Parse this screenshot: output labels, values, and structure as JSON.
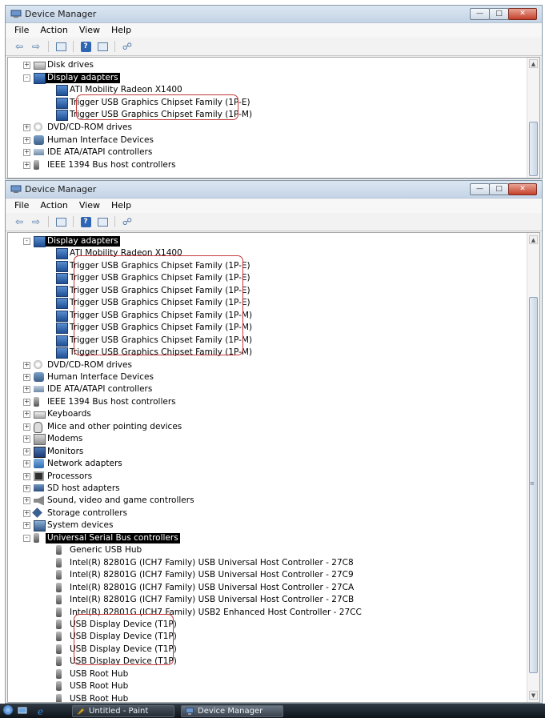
{
  "window1": {
    "title": "Device Manager",
    "menu": [
      "File",
      "Action",
      "View",
      "Help"
    ],
    "tree": [
      {
        "label": "Disk drives",
        "level": 1,
        "icon": "disk-drive-icon",
        "expander": "+"
      },
      {
        "label": "Display adapters",
        "level": 1,
        "icon": "display-adapter-icon",
        "expander": "-",
        "selected": true
      },
      {
        "label": "ATI Mobility Radeon X1400",
        "level": 2,
        "icon": "display-adapter-icon"
      },
      {
        "label": "Trigger USB Graphics Chipset Family (1P-E)",
        "level": 2,
        "icon": "display-adapter-icon"
      },
      {
        "label": "Trigger USB Graphics Chipset Family (1P-M)",
        "level": 2,
        "icon": "display-adapter-icon"
      },
      {
        "label": "DVD/CD-ROM drives",
        "level": 1,
        "icon": "dvd-drive-icon",
        "expander": "+"
      },
      {
        "label": "Human Interface Devices",
        "level": 1,
        "icon": "human-interface-icon",
        "expander": "+"
      },
      {
        "label": "IDE ATA/ATAPI controllers",
        "level": 1,
        "icon": "ide-controller-icon",
        "expander": "+"
      },
      {
        "label": "IEEE 1394 Bus host controllers",
        "level": 1,
        "icon": "usb-plug-icon",
        "expander": "+"
      }
    ]
  },
  "window2": {
    "title": "Device Manager",
    "menu": [
      "File",
      "Action",
      "View",
      "Help"
    ],
    "tree": [
      {
        "label": "Display adapters",
        "level": 1,
        "icon": "display-adapter-icon",
        "expander": "-",
        "selected": true
      },
      {
        "label": "ATI Mobility Radeon X1400",
        "level": 2,
        "icon": "display-adapter-icon"
      },
      {
        "label": "Trigger USB Graphics Chipset Family (1P-E)",
        "level": 2,
        "icon": "display-adapter-icon"
      },
      {
        "label": "Trigger USB Graphics Chipset Family (1P-E)",
        "level": 2,
        "icon": "display-adapter-icon"
      },
      {
        "label": "Trigger USB Graphics Chipset Family (1P-E)",
        "level": 2,
        "icon": "display-adapter-icon"
      },
      {
        "label": "Trigger USB Graphics Chipset Family (1P-E)",
        "level": 2,
        "icon": "display-adapter-icon"
      },
      {
        "label": "Trigger USB Graphics Chipset Family (1P-M)",
        "level": 2,
        "icon": "display-adapter-icon"
      },
      {
        "label": "Trigger USB Graphics Chipset Family (1P-M)",
        "level": 2,
        "icon": "display-adapter-icon"
      },
      {
        "label": "Trigger USB Graphics Chipset Family (1P-M)",
        "level": 2,
        "icon": "display-adapter-icon"
      },
      {
        "label": "Trigger USB Graphics Chipset Family (1P-M)",
        "level": 2,
        "icon": "display-adapter-icon"
      },
      {
        "label": "DVD/CD-ROM drives",
        "level": 1,
        "icon": "dvd-drive-icon",
        "expander": "+"
      },
      {
        "label": "Human Interface Devices",
        "level": 1,
        "icon": "human-interface-icon",
        "expander": "+"
      },
      {
        "label": "IDE ATA/ATAPI controllers",
        "level": 1,
        "icon": "ide-controller-icon",
        "expander": "+"
      },
      {
        "label": "IEEE 1394 Bus host controllers",
        "level": 1,
        "icon": "usb-plug-icon",
        "expander": "+"
      },
      {
        "label": "Keyboards",
        "level": 1,
        "icon": "keyboard-icon",
        "expander": "+"
      },
      {
        "label": "Mice and other pointing devices",
        "level": 1,
        "icon": "mouse-icon",
        "expander": "+"
      },
      {
        "label": "Modems",
        "level": 1,
        "icon": "modem-icon",
        "expander": "+"
      },
      {
        "label": "Monitors",
        "level": 1,
        "icon": "monitor-icon",
        "expander": "+"
      },
      {
        "label": "Network adapters",
        "level": 1,
        "icon": "network-adapter-icon",
        "expander": "+"
      },
      {
        "label": "Processors",
        "level": 1,
        "icon": "processor-icon",
        "expander": "+"
      },
      {
        "label": "SD host adapters",
        "level": 1,
        "icon": "sd-host-icon",
        "expander": "+"
      },
      {
        "label": "Sound, video and game controllers",
        "level": 1,
        "icon": "speaker-icon",
        "expander": "+"
      },
      {
        "label": "Storage controllers",
        "level": 1,
        "icon": "storage-controller-icon",
        "expander": "+"
      },
      {
        "label": "System devices",
        "level": 1,
        "icon": "system-device-icon",
        "expander": "+"
      },
      {
        "label": "Universal Serial Bus controllers",
        "level": 1,
        "icon": "usb-plug-icon",
        "expander": "-",
        "selected": true
      },
      {
        "label": "Generic USB Hub",
        "level": 2,
        "icon": "usb-plug-icon"
      },
      {
        "label": "Intel(R) 82801G (ICH7 Family) USB Universal Host Controller - 27C8",
        "level": 2,
        "icon": "usb-plug-icon"
      },
      {
        "label": "Intel(R) 82801G (ICH7 Family) USB Universal Host Controller - 27C9",
        "level": 2,
        "icon": "usb-plug-icon"
      },
      {
        "label": "Intel(R) 82801G (ICH7 Family) USB Universal Host Controller - 27CA",
        "level": 2,
        "icon": "usb-plug-icon"
      },
      {
        "label": "Intel(R) 82801G (ICH7 Family) USB Universal Host Controller - 27CB",
        "level": 2,
        "icon": "usb-plug-icon"
      },
      {
        "label": "Intel(R) 82801G (ICH7 Family) USB2 Enhanced Host Controller - 27CC",
        "level": 2,
        "icon": "usb-plug-icon"
      },
      {
        "label": "USB Display Device (T1P)",
        "level": 2,
        "icon": "usb-plug-icon"
      },
      {
        "label": "USB Display Device (T1P)",
        "level": 2,
        "icon": "usb-plug-icon"
      },
      {
        "label": "USB Display Device (T1P)",
        "level": 2,
        "icon": "usb-plug-icon"
      },
      {
        "label": "USB Display Device (T1P)",
        "level": 2,
        "icon": "usb-plug-icon"
      },
      {
        "label": "USB Root Hub",
        "level": 2,
        "icon": "usb-plug-icon"
      },
      {
        "label": "USB Root Hub",
        "level": 2,
        "icon": "usb-plug-icon"
      },
      {
        "label": "USB Root Hub",
        "level": 2,
        "icon": "usb-plug-icon"
      }
    ]
  },
  "taskbar": {
    "buttons": [
      {
        "label": "Untitled - Paint",
        "active": false
      },
      {
        "label": "Device Manager",
        "active": true
      }
    ]
  },
  "colors": {
    "highlight_outline": "#c43a3a",
    "selection_bg": "#000000",
    "selection_fg": "#ffffff"
  }
}
